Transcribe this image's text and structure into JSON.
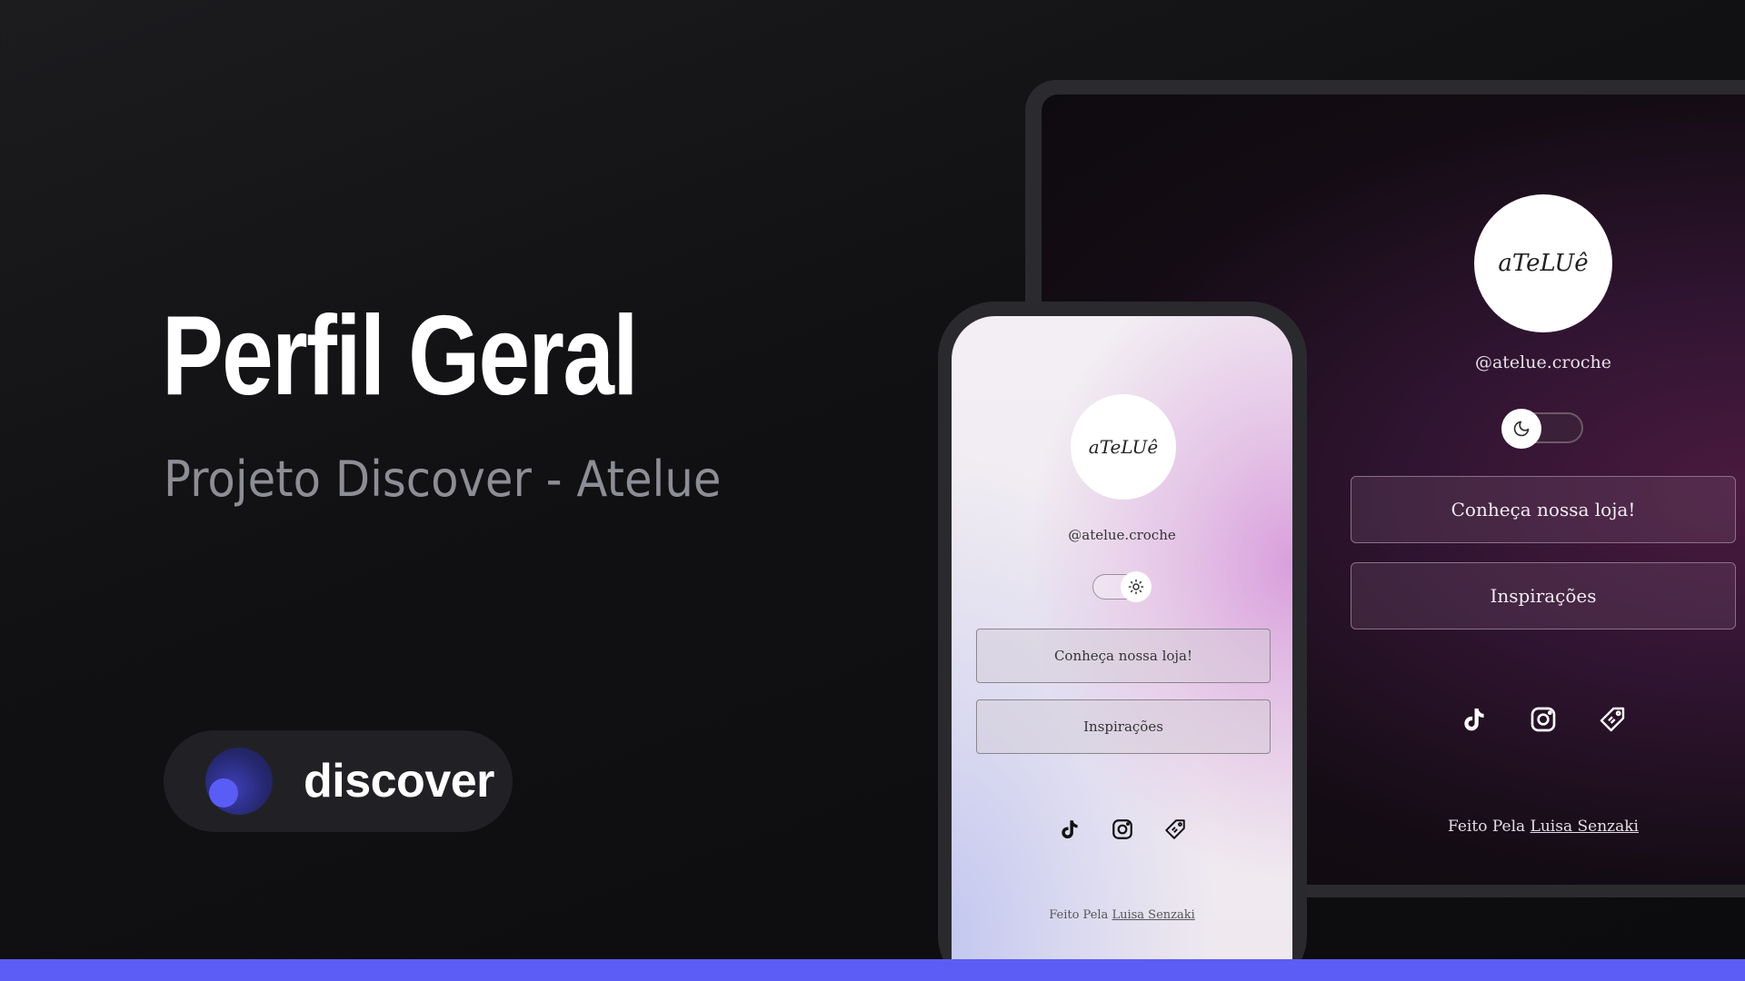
{
  "hero": {
    "title": "Perfil Geral",
    "subtitle": "Projeto Discover - Atelue"
  },
  "badge": {
    "label": "discover",
    "logo_icon": "discover-logo-icon"
  },
  "profile_dark": {
    "logo_text": "aTeLUê",
    "handle": "@atelue.croche",
    "toggle_icon": "moon-icon",
    "buttons": [
      "Conheça nossa loja!",
      "Inspirações"
    ],
    "socials": [
      "tiktok-icon",
      "instagram-icon",
      "tag-icon"
    ],
    "footer_prefix": "Feito Pela",
    "footer_author": "Luisa Senzaki"
  },
  "profile_light": {
    "logo_text": "aTeLUê",
    "handle": "@atelue.croche",
    "toggle_icon": "sun-icon",
    "buttons": [
      "Conheça nossa loja!",
      "Inspirações"
    ],
    "socials": [
      "tiktok-icon",
      "instagram-icon",
      "tag-icon"
    ],
    "footer_prefix": "Feito Pela",
    "footer_author": "Luisa Senzaki"
  },
  "colors": {
    "accent": "#5b5df4",
    "background": "#111113",
    "dark_profile_bg": "#2f1430"
  }
}
